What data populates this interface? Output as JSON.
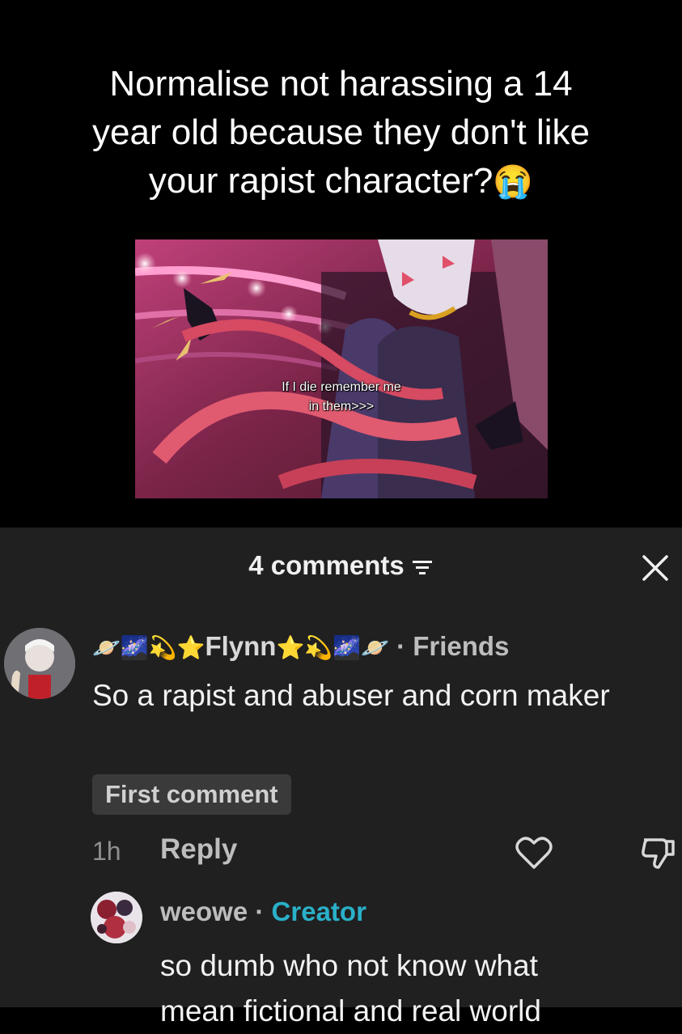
{
  "post": {
    "headline_line1": "Normalise not harassing a 14",
    "headline_line2": "year old because they don't like",
    "headline_line3": "your rapist character?",
    "headline_emoji": "😭",
    "media_caption_line1": "If I die remember me",
    "media_caption_line2": "in them>>>"
  },
  "comments_sheet": {
    "count_label": "4 comments",
    "filter_icon": "sort-lines-icon",
    "close_icon": "close-x-icon",
    "background": "#202020",
    "comments": [
      {
        "name_prefix_emoji": "🪐🌌💫⭐",
        "username": "Flynn",
        "name_suffix_emoji": "⭐💫🌌🪐",
        "relation": "· Friends",
        "text": "So a rapist and abuser and corn maker",
        "badge": "First comment",
        "time": "1h",
        "reply_label": "Reply",
        "like_icon": "heart-outline-icon",
        "dislike_icon": "thumbs-down-icon"
      },
      {
        "username": "weowe",
        "separator": "·",
        "role": "Creator",
        "role_color": "#2ab0c8",
        "text_line1": "so dumb who not know what",
        "text_line2": "mean fictional and real world"
      }
    ]
  }
}
